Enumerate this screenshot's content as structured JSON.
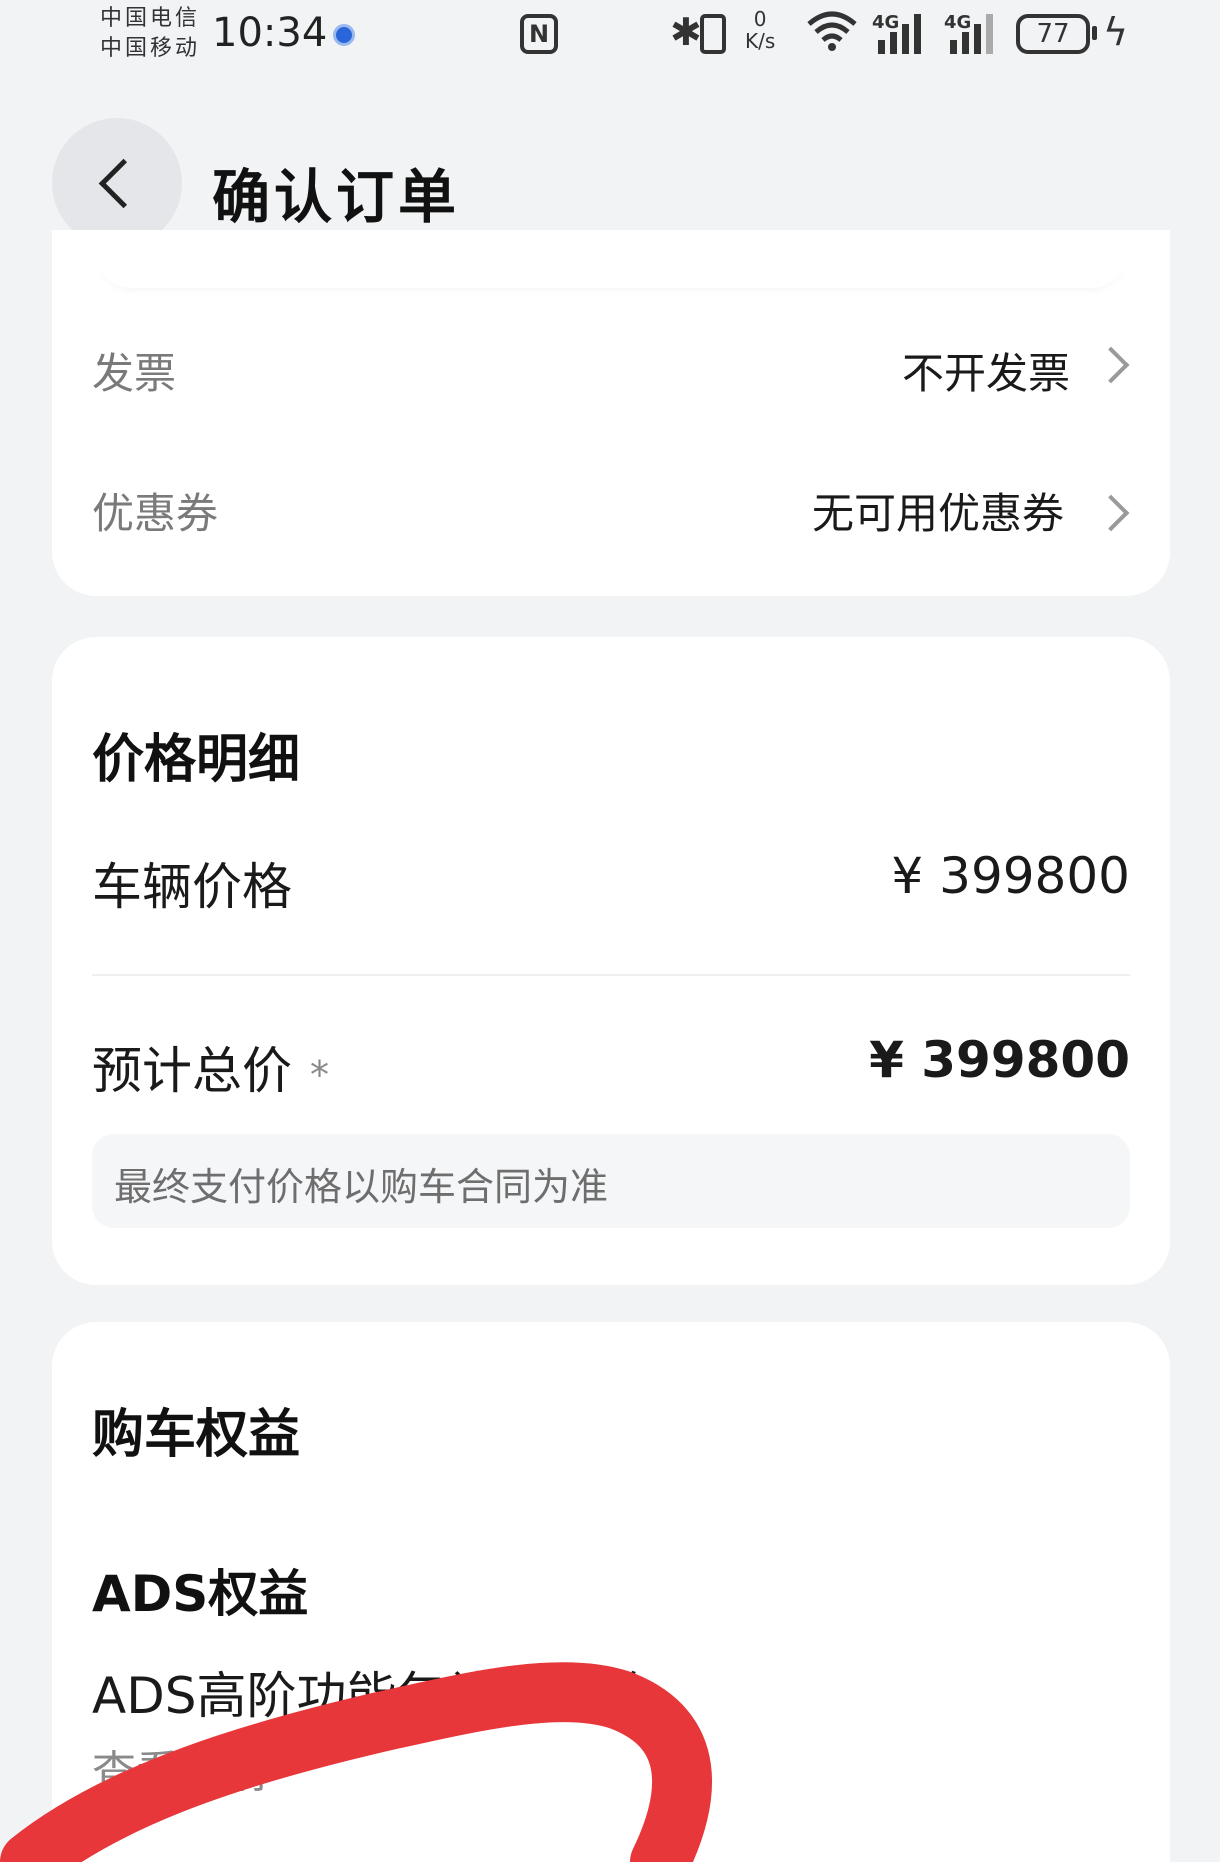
{
  "status_bar": {
    "carrier_1": "中国电信",
    "carrier_2": "中国移动",
    "time": "10:34",
    "net_speed_value": "0",
    "net_speed_unit": "K/s",
    "signal_1_label": "4G",
    "signal_2_label": "4G",
    "battery_level": "77",
    "icons": [
      "location-icon",
      "nfc-icon",
      "bluetooth-icon",
      "vibrate-icon",
      "wifi-icon",
      "signal-icon",
      "battery-icon",
      "charging-icon"
    ]
  },
  "header": {
    "title": "确认订单",
    "back_icon": "chevron-left-icon"
  },
  "invoice_card": {
    "invoice_label": "发票",
    "invoice_value": "不开发票",
    "coupon_label": "优惠券",
    "coupon_value": "无可用优惠券"
  },
  "price_card": {
    "title": "价格明细",
    "vehicle_price_label": "车辆价格",
    "vehicle_price_value": "¥ 399800",
    "total_label": "预计总价",
    "total_asterisk": "*",
    "total_value": "¥ 399800",
    "note": "最终支付价格以购车合同为准"
  },
  "benefit_card": {
    "title": "购车权益",
    "section": "ADS权益",
    "benefit_name": "ADS高阶功能包补贴权益",
    "view_details": "查看详情"
  },
  "colors": {
    "background": "#f1f3f5",
    "card": "#ffffff",
    "annotation_red": "#e8373a"
  }
}
